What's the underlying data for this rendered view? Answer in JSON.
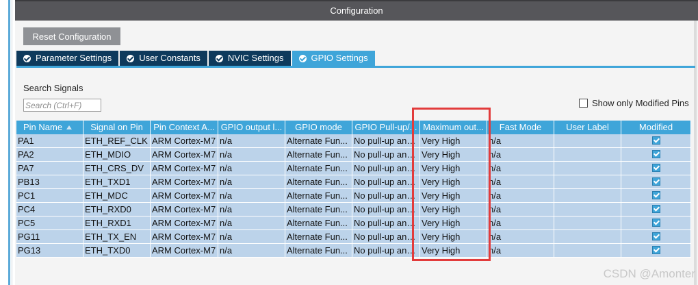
{
  "panel": {
    "title": "Configuration"
  },
  "toolbar": {
    "reset_label": "Reset Configuration"
  },
  "tabs": [
    {
      "label": "Parameter Settings",
      "active": false
    },
    {
      "label": "User Constants",
      "active": false
    },
    {
      "label": "NVIC Settings",
      "active": false
    },
    {
      "label": "GPIO Settings",
      "active": true
    }
  ],
  "search": {
    "label": "Search Signals",
    "placeholder": "Search (Ctrl+F)"
  },
  "filter": {
    "show_modified_label": "Show only Modified Pins",
    "checked": false
  },
  "table": {
    "columns": [
      "Pin Name",
      "Signal on Pin",
      "Pin Context A...",
      "GPIO output l...",
      "GPIO mode",
      "GPIO Pull-up/...",
      "Maximum out...",
      "Fast Mode",
      "User Label",
      "Modified"
    ],
    "rows": [
      {
        "pin": "PA1",
        "signal": "ETH_REF_CLK",
        "context": "ARM Cortex-M7",
        "output": "n/a",
        "mode": "Alternate Fun...",
        "pull": "No pull-up and...",
        "speed": "Very High",
        "fast": "n/a",
        "user": "",
        "modified": true
      },
      {
        "pin": "PA2",
        "signal": "ETH_MDIO",
        "context": "ARM Cortex-M7",
        "output": "n/a",
        "mode": "Alternate Fun...",
        "pull": "No pull-up and...",
        "speed": "Very High",
        "fast": "n/a",
        "user": "",
        "modified": true
      },
      {
        "pin": "PA7",
        "signal": "ETH_CRS_DV",
        "context": "ARM Cortex-M7",
        "output": "n/a",
        "mode": "Alternate Fun...",
        "pull": "No pull-up and...",
        "speed": "Very High",
        "fast": "n/a",
        "user": "",
        "modified": true
      },
      {
        "pin": "PB13",
        "signal": "ETH_TXD1",
        "context": "ARM Cortex-M7",
        "output": "n/a",
        "mode": "Alternate Fun...",
        "pull": "No pull-up and...",
        "speed": "Very High",
        "fast": "n/a",
        "user": "",
        "modified": true
      },
      {
        "pin": "PC1",
        "signal": "ETH_MDC",
        "context": "ARM Cortex-M7",
        "output": "n/a",
        "mode": "Alternate Fun...",
        "pull": "No pull-up and...",
        "speed": "Very High",
        "fast": "n/a",
        "user": "",
        "modified": true
      },
      {
        "pin": "PC4",
        "signal": "ETH_RXD0",
        "context": "ARM Cortex-M7",
        "output": "n/a",
        "mode": "Alternate Fun...",
        "pull": "No pull-up and...",
        "speed": "Very High",
        "fast": "n/a",
        "user": "",
        "modified": true
      },
      {
        "pin": "PC5",
        "signal": "ETH_RXD1",
        "context": "ARM Cortex-M7",
        "output": "n/a",
        "mode": "Alternate Fun...",
        "pull": "No pull-up and...",
        "speed": "Very High",
        "fast": "n/a",
        "user": "",
        "modified": true
      },
      {
        "pin": "PG11",
        "signal": "ETH_TX_EN",
        "context": "ARM Cortex-M7",
        "output": "n/a",
        "mode": "Alternate Fun...",
        "pull": "No pull-up and...",
        "speed": "Very High",
        "fast": "n/a",
        "user": "",
        "modified": true
      },
      {
        "pin": "PG13",
        "signal": "ETH_TXD0",
        "context": "ARM Cortex-M7",
        "output": "n/a",
        "mode": "Alternate Fun...",
        "pull": "No pull-up and...",
        "speed": "Very High",
        "fast": "n/a",
        "user": "",
        "modified": true
      }
    ]
  },
  "watermark": "CSDN @Amonter",
  "colors": {
    "accent": "#3fa5d9",
    "tab_dark": "#0e3a5c",
    "titlebar": "#56565a",
    "row": "#bcd3ea",
    "highlight": "#e23b3b"
  },
  "icons": {
    "tab_check": "check-circle-icon",
    "sort": "sort-up-icon",
    "modified": "checkbox-checked-icon"
  }
}
